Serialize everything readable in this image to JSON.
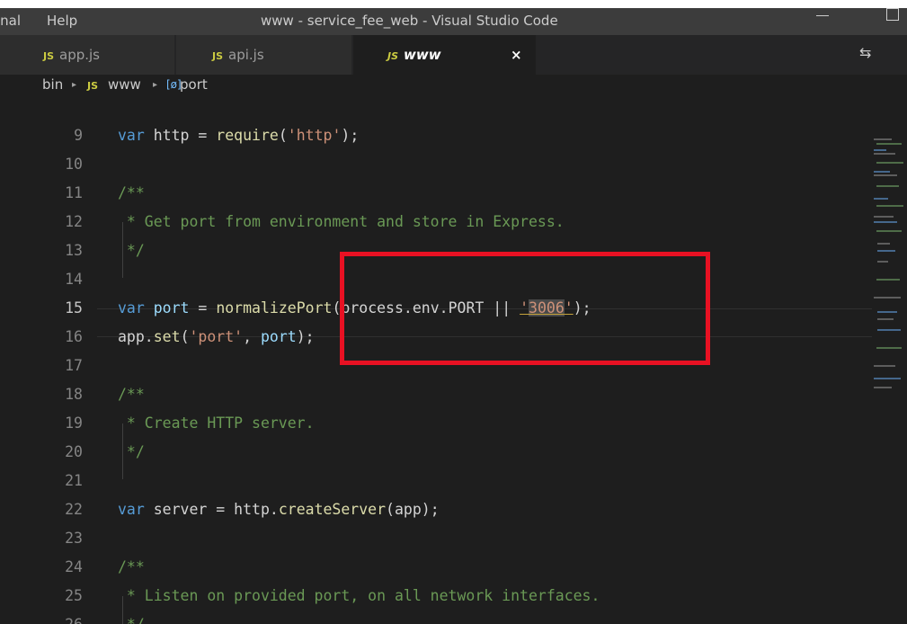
{
  "menu": {
    "terminal": "inal",
    "help": "Help"
  },
  "window_title": "www - service_fee_web - Visual Studio Code",
  "tabs": [
    {
      "badge": "JS",
      "label": "app.js"
    },
    {
      "badge": "JS",
      "label": "api.js"
    },
    {
      "badge": "JS",
      "label": "www",
      "close": "×"
    }
  ],
  "breadcrumb": {
    "folder": "bin",
    "sep": "▸",
    "badge": "JS",
    "file": "www",
    "symbol_icon": "[ø]",
    "symbol": "port"
  },
  "icons": {
    "compare": "⇆"
  },
  "code": [
    {
      "n": "9",
      "t": [
        [
          "kw",
          "var "
        ],
        [
          "plain",
          "http = "
        ],
        [
          "fn",
          "require"
        ],
        [
          "plain",
          "("
        ],
        [
          "str",
          "'http'"
        ],
        [
          "plain",
          ");"
        ]
      ]
    },
    {
      "n": "10",
      "t": []
    },
    {
      "n": "11",
      "t": [
        [
          "cm",
          "/**"
        ]
      ]
    },
    {
      "n": "12",
      "t": [
        [
          "cm",
          " * Get port from environment and store in Express."
        ]
      ]
    },
    {
      "n": "13",
      "t": [
        [
          "cm",
          " */"
        ]
      ]
    },
    {
      "n": "14",
      "t": []
    },
    {
      "n": "15",
      "t": [
        [
          "kw",
          "var "
        ],
        [
          "id",
          "port"
        ],
        [
          "plain",
          " = "
        ],
        [
          "fn",
          "normalizePort"
        ],
        [
          "plain",
          "(process.env.PORT || "
        ],
        [
          "str",
          "'3006'"
        ],
        [
          "plain",
          ");"
        ]
      ]
    },
    {
      "n": "16",
      "t": [
        [
          "plain",
          "app."
        ],
        [
          "fn",
          "set"
        ],
        [
          "plain",
          "("
        ],
        [
          "str",
          "'port'"
        ],
        [
          "plain",
          ", "
        ],
        [
          "id",
          "port"
        ],
        [
          "plain",
          ");"
        ]
      ]
    },
    {
      "n": "17",
      "t": []
    },
    {
      "n": "18",
      "t": [
        [
          "cm",
          "/**"
        ]
      ]
    },
    {
      "n": "19",
      "t": [
        [
          "cm",
          " * Create HTTP server."
        ]
      ]
    },
    {
      "n": "20",
      "t": [
        [
          "cm",
          " */"
        ]
      ]
    },
    {
      "n": "21",
      "t": []
    },
    {
      "n": "22",
      "t": [
        [
          "kw",
          "var "
        ],
        [
          "plain",
          "server = http."
        ],
        [
          "fn",
          "createServer"
        ],
        [
          "plain",
          "(app);"
        ]
      ]
    },
    {
      "n": "23",
      "t": []
    },
    {
      "n": "24",
      "t": [
        [
          "cm",
          "/**"
        ]
      ]
    },
    {
      "n": "25",
      "t": [
        [
          "cm",
          " * Listen on provided port, on all network interfaces."
        ]
      ]
    },
    {
      "n": "26",
      "t": [
        [
          "cm",
          " */"
        ]
      ]
    }
  ]
}
